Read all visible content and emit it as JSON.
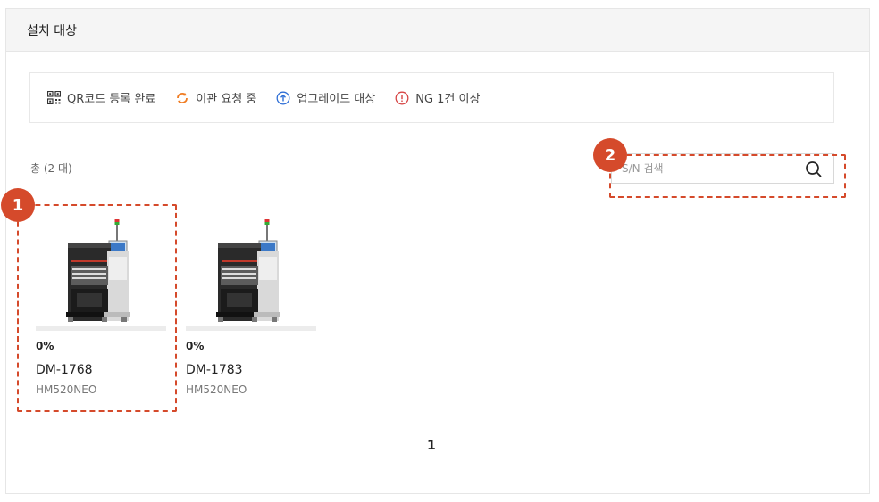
{
  "panel": {
    "title": "설치 대상"
  },
  "legend": {
    "items": [
      {
        "label": "QR코드 등록 완료",
        "icon": "qr-code-icon",
        "color": "#333333"
      },
      {
        "label": "이관 요청 중",
        "icon": "refresh-icon",
        "color": "#f07c22"
      },
      {
        "label": "업그레이드 대상",
        "icon": "upgrade-arrow-icon",
        "color": "#2f6fd6"
      },
      {
        "label": "NG 1건 이상",
        "icon": "warning-icon",
        "color": "#d64545"
      }
    ]
  },
  "list": {
    "total": "총 (2 대)"
  },
  "search": {
    "placeholder": "S/N 검색",
    "icon": "search-icon"
  },
  "devices": [
    {
      "progress": "0%",
      "progress_value": 0,
      "serial": "DM-1768",
      "model": "HM520NEO"
    },
    {
      "progress": "0%",
      "progress_value": 0,
      "serial": "DM-1783",
      "model": "HM520NEO"
    }
  ],
  "pagination": {
    "current": "1"
  },
  "annotations": [
    {
      "number": "1"
    },
    {
      "number": "2"
    }
  ],
  "colors": {
    "annotation": "#d54a2b",
    "progress": "#2f7de1"
  }
}
